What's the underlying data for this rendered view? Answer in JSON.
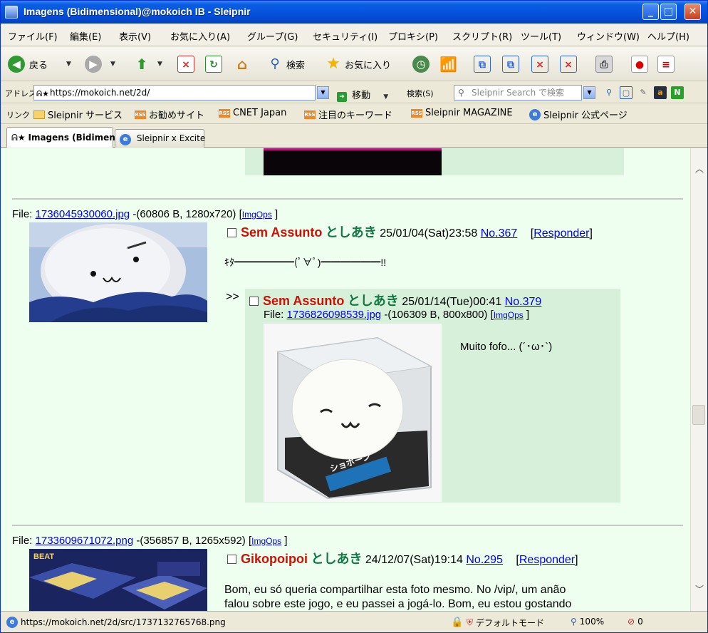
{
  "window": {
    "title": "Imagens (Bidimensional)@mokoich IB - Sleipnir",
    "controls": [
      "_",
      "□",
      "✕"
    ]
  },
  "menu": [
    "ファイル(F)",
    "編集(E)",
    "表示(V)",
    "お気に入り(A)",
    "グループ(G)",
    "セキュリティ(I)",
    "プロキシ(P)",
    "スクリプト(R)",
    "ツール(T)",
    "ウィンドウ(W)",
    "ヘルプ(H)"
  ],
  "toolbar": {
    "back_label": "戻る",
    "search_label": "検索",
    "favorites_label": "お気に入り"
  },
  "address": {
    "label": "アドレス(D)",
    "url": "https://mokoich.net/2d/",
    "go_label": "移動",
    "search_label": "検索(S)",
    "search_placeholder": "Sleipnir Search で検索"
  },
  "links": {
    "label": "リンク",
    "items": [
      "Sleipnir サービス",
      "お勧めサイト",
      "CNET Japan",
      "注目のキーワード",
      "Sleipnir MAGAZINE",
      "Sleipnir 公式ページ"
    ]
  },
  "tabs": [
    {
      "label": "Imagens (Bidimen..."
    },
    {
      "label": "Sleipnir x Excite"
    }
  ],
  "posts": [
    {
      "file_label": "File: ",
      "file_name": "1736045930060.jpg",
      "file_info": " -(60806 B, 1280x720) [",
      "imgops": "ImgOps",
      "close_bracket": "]",
      "subject": "Sem Assunto",
      "name": "としあき",
      "date": "25/01/04(Sat)23:58",
      "number": "No.367",
      "respond": "Responder",
      "body": "ｷﾀ━━━━━━(ﾟ∀ﾟ)━━━━━━!!"
    },
    {
      "file_label": "File: ",
      "file_name": "1733609671072.png",
      "file_info": " -(356857 B, 1265x592) [",
      "imgops": "ImgOps",
      "close_bracket": "]",
      "subject": "Gikopoipoi",
      "name": "としあき",
      "date": "24/12/07(Sat)19:14",
      "number": "No.295",
      "respond": "Responder",
      "body_line1": "Bom, eu só queria compartilhar esta foto mesmo. No /vip/, um anão",
      "body_line2": "falou sobre este jogo, e eu passei a jogá-lo. Bom, eu estou gostando"
    }
  ],
  "reply": {
    "marker": ">>",
    "subject": "Sem Assunto",
    "name": "としあき",
    "date": "25/01/14(Tue)00:41",
    "number": "No.379",
    "file_label": "File: ",
    "file_name": "1736826098539.jpg",
    "file_info": " -(106309 B, 800x800) [",
    "imgops": "ImgOps",
    "close_bracket": "]",
    "body": "Muito fofo... (´･ω･`)",
    "image_text": "ショボーン"
  },
  "status": {
    "url": "https://mokoich.net/2d/src/1737132765768.png",
    "mode": "デフォルトモード",
    "zoom": "100%",
    "blocked": "0"
  }
}
